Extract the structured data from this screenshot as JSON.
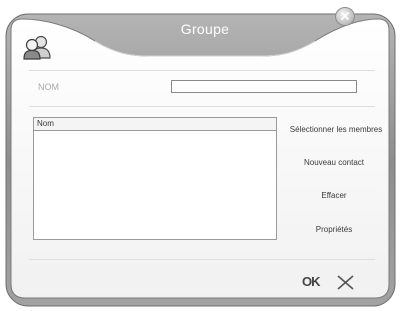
{
  "window": {
    "title": "Groupe"
  },
  "form": {
    "nom_label": "NOM",
    "nom_value": "",
    "nom_placeholder": ""
  },
  "members_list": {
    "column_header": "Nom",
    "rows": []
  },
  "actions": {
    "select_members": "Sélectionner les membres",
    "new_contact": "Nouveau contact",
    "delete": "Effacer",
    "properties": "Propriétés"
  },
  "footer": {
    "ok_label": "OK"
  },
  "icons": {
    "close": "close-icon",
    "group": "group-icon",
    "cancel": "cancel-x-icon"
  },
  "colors": {
    "frame": "#8c8c8c",
    "panel": "#f6f6f6",
    "title_text": "#ffffff"
  }
}
